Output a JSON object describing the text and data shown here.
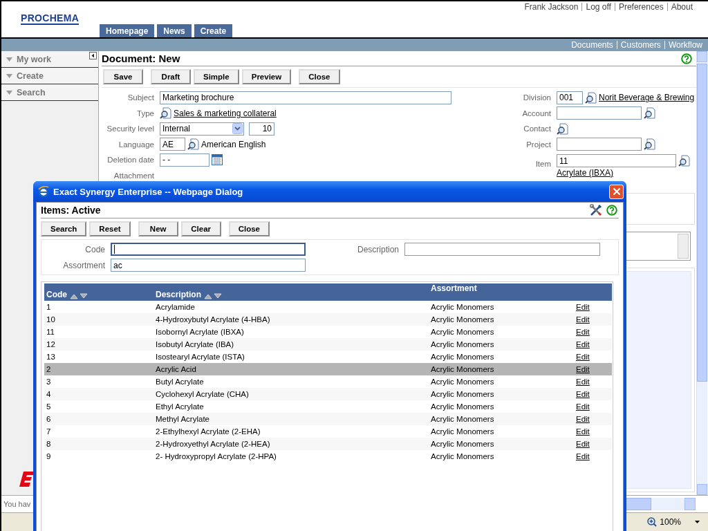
{
  "header": {
    "logo": "PROCHEMA",
    "user_links": [
      "Frank Jackson",
      "Log off",
      "Preferences",
      "About"
    ],
    "tabs": [
      "Homepage",
      "News",
      "Create"
    ]
  },
  "nav_links": [
    "Documents",
    "Customers",
    "Workflow"
  ],
  "sidebar": {
    "items": [
      "My work",
      "Create",
      "Search"
    ]
  },
  "document": {
    "title": "Document: New",
    "buttons": [
      "Save",
      "Draft",
      "Simple",
      "Preview",
      "Close"
    ],
    "left_fields": [
      {
        "label": "Subject",
        "kind": "text",
        "value": "Marketing brochure"
      },
      {
        "label": "Type",
        "kind": "lookup-link",
        "value": "Sales & marketing collateral"
      },
      {
        "label": "Security level",
        "kind": "select",
        "value": "Internal",
        "extra": "10"
      },
      {
        "label": "Language",
        "kind": "code-lookup",
        "value": "AE",
        "text": "American English"
      },
      {
        "label": "Deletion date",
        "kind": "date",
        "value": "- -"
      },
      {
        "label": "Attachment",
        "kind": "label"
      }
    ],
    "right_fields": [
      {
        "label": "Division",
        "kind": "code-link",
        "value": "001",
        "link": "Norit Beverage & Brewing"
      },
      {
        "label": "Account",
        "kind": "input-lookup"
      },
      {
        "label": "Contact",
        "kind": "lookup"
      },
      {
        "label": "Project",
        "kind": "input-lookup"
      },
      {
        "label": "Item",
        "kind": "input-lookup",
        "value": "11",
        "link": "Acrylate (IBXA)"
      }
    ]
  },
  "dialog": {
    "title": "Exact Synergy Enterprise -- Webpage Dialog",
    "heading": "Items: Active",
    "buttons": [
      "Search",
      "Reset",
      "New",
      "Clear",
      "Close"
    ],
    "filters": [
      {
        "label": "Code",
        "focused": true
      },
      {
        "label": "Description",
        "focused": false
      },
      {
        "label": "Assortment",
        "value": "ac",
        "focused": false
      }
    ],
    "columns": [
      {
        "label": "Code",
        "sortable": true
      },
      {
        "label": "Description",
        "sortable": true
      },
      {
        "label": "Assortment",
        "sortable": false
      }
    ],
    "rows": [
      {
        "code": "1",
        "description": "Acrylamide",
        "assortment": "Acrylic Monomers",
        "action": "Edit",
        "selected": false
      },
      {
        "code": "10",
        "description": "4-Hydroxybutyl Acrylate (4-HBA)",
        "assortment": "Acrylic Monomers",
        "action": "Edit",
        "selected": false
      },
      {
        "code": "11",
        "description": "Isobornyl Acrylate (IBXA)",
        "assortment": "Acrylic Monomers",
        "action": "Edit",
        "selected": false
      },
      {
        "code": "12",
        "description": "Isobutyl Acrylate (IBA)",
        "assortment": "Acrylic Monomers",
        "action": "Edit",
        "selected": false
      },
      {
        "code": "13",
        "description": "Isostearyl Acrylate (ISTA)",
        "assortment": "Acrylic Monomers",
        "action": "Edit",
        "selected": false
      },
      {
        "code": "2",
        "description": "Acrylic Acid",
        "assortment": "Acrylic Monomers",
        "action": "Edit",
        "selected": true
      },
      {
        "code": "3",
        "description": "Butyl Acrylate",
        "assortment": "Acrylic Monomers",
        "action": "Edit",
        "selected": false
      },
      {
        "code": "4",
        "description": "Cyclohexyl Acrylate (CHA)",
        "assortment": "Acrylic Monomers",
        "action": "Edit",
        "selected": false
      },
      {
        "code": "5",
        "description": "Ethyl Acrylate",
        "assortment": "Acrylic Monomers",
        "action": "Edit",
        "selected": false
      },
      {
        "code": "6",
        "description": "Methyl Acrylate",
        "assortment": "Acrylic Monomers",
        "action": "Edit",
        "selected": false
      },
      {
        "code": "7",
        "description": "2-Ethylhexyl Acrylate (2-EHA)",
        "assortment": "Acrylic Monomers",
        "action": "Edit",
        "selected": false
      },
      {
        "code": "8",
        "description": "2-Hydroxyethyl Acrylate (2-HEA)",
        "assortment": "Acrylic Monomers",
        "action": "Edit",
        "selected": false
      },
      {
        "code": "9",
        "description": "2- Hydroxypropyl Acrylate (2-HPA)",
        "assortment": "Acrylic Monomers",
        "action": "Edit",
        "selected": false
      }
    ]
  },
  "status": {
    "message": "You hav",
    "zoom": "100%"
  }
}
